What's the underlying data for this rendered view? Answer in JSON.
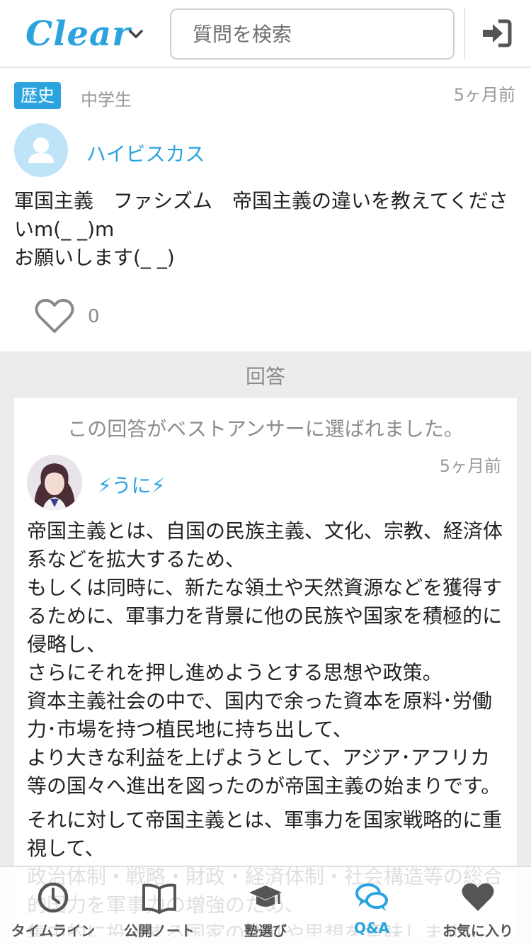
{
  "colors": {
    "brand": "#2aa3df",
    "muted": "#9a9a9a"
  },
  "header": {
    "logo": "Clear",
    "search_placeholder": "質問を検索",
    "login_icon": "login-icon"
  },
  "question": {
    "subject": "歴史",
    "grade": "中学生",
    "time": "5ヶ月前",
    "user": "ハイビスカス",
    "text": "軍国主義　ファシズム　帝国主義の違いを教えてくださいm(_ _)m\nお願いします(_ _)",
    "likes": "0"
  },
  "answers": {
    "title": "回答",
    "best_note": "この回答がベストアンサーに選ばれました。",
    "time": "5ヶ月前",
    "user": "⚡うに⚡",
    "paragraphs": [
      "帝国主義とは、自国の民族主義、文化、宗教、経済体系などを拡大するため、\nもしくは同時に、新たな領土や天然資源などを獲得するために、軍事力を背景に他の民族や国家を積極的に侵略し、\nさらにそれを押し進めようとする思想や政策。\n資本主義社会の中で、国内で余った資本を原料･労働力･市場を持つ植民地に持ち出して、\nより大きな利益を上げようとして、アジア･アフリカ等の国々へ進出を図ったのが帝国主義の始まりです。",
      "それに対して帝国主義とは、軍事力を国家戦略的に重視して、\n政治体制・戦略・財政・経済体制・社会構造等の総合的国力を軍事力の増強のため、\n集中的に投入する国家の体制や思想を意味します。"
    ]
  },
  "nav": [
    {
      "label": "タイムライン",
      "icon": "clock-icon",
      "active": false
    },
    {
      "label": "公開ノート",
      "icon": "book-icon",
      "active": false
    },
    {
      "label": "塾選び",
      "icon": "graduation-cap-icon",
      "active": false
    },
    {
      "label": "Q&A",
      "icon": "chat-bubbles-icon",
      "active": true
    },
    {
      "label": "お気に入り",
      "icon": "heart-icon",
      "active": false
    }
  ]
}
